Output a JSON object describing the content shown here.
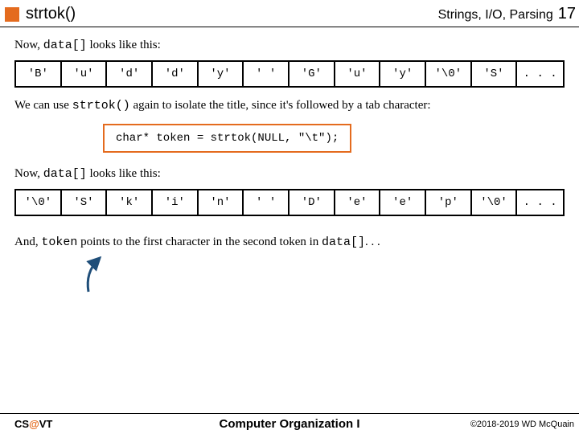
{
  "header": {
    "title": "strtok()",
    "section": "Strings, I/O, Parsing",
    "slide": "17"
  },
  "body": {
    "line1a": "Now, ",
    "line1b": "data[]",
    "line1c": " looks like this:",
    "array1": [
      "'B'",
      "'u'",
      "'d'",
      "'d'",
      "'y'",
      "' '",
      "'G'",
      "'u'",
      "'y'",
      "'\\0'",
      "'S'",
      ". . ."
    ],
    "line2a": "We can use ",
    "line2b": "strtok()",
    "line2c": " again to isolate the title, since it's followed by a tab character:",
    "code": "char* token = strtok(NULL, \"\\t\");",
    "line3a": "Now, ",
    "line3b": "data[]",
    "line3c": " looks like this:",
    "array2": [
      "'\\0'",
      "'S'",
      "'k'",
      "'i'",
      "'n'",
      "' '",
      "'D'",
      "'e'",
      "'e'",
      "'p'",
      "'\\0'",
      ". . ."
    ],
    "line4a": "And, ",
    "line4b": "token",
    "line4c": " points to the first character in the second token in ",
    "line4d": "data[]",
    "line4e": ". . ."
  },
  "footer": {
    "left_cs": "CS",
    "left_at": "@",
    "left_vt": "VT",
    "center": "Computer Organization I",
    "right": "©2018-2019 WD McQuain"
  }
}
